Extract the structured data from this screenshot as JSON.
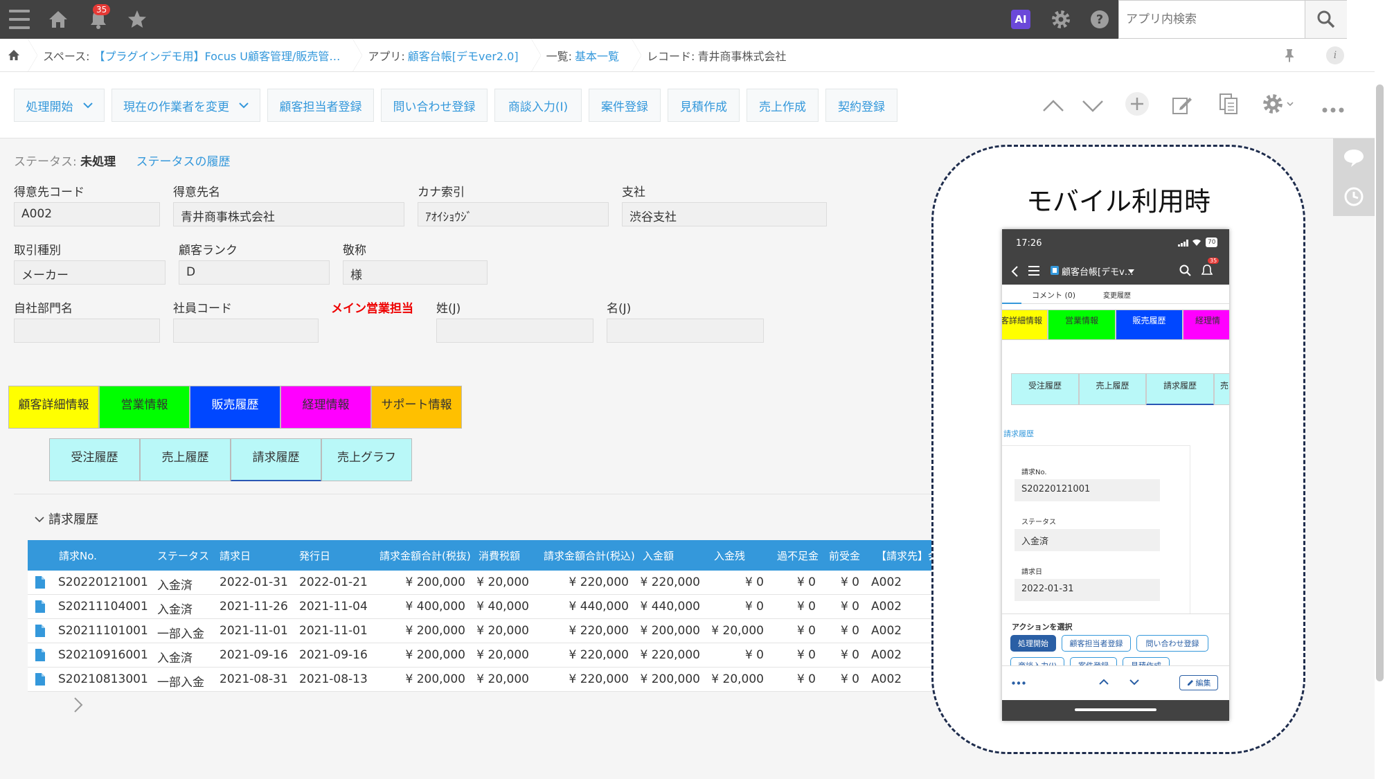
{
  "header": {
    "notification_count": "35",
    "ai_label": "AI",
    "search_placeholder": "アプリ内検索"
  },
  "breadcrumb": {
    "space_label": "スペース:",
    "space_name": "【プラグインデモ用】Focus U顧客管理/販売管…",
    "app_label": "アプリ:",
    "app_name": "顧客台帳[デモver2.0]",
    "view_label": "一覧:",
    "view_name": "基本一覧",
    "record_label": "レコード:",
    "record_name": "青井商事株式会社"
  },
  "toolbar": {
    "buttons": [
      "処理開始",
      "現在の作業者を変更",
      "顧客担当者登録",
      "問い合わせ登録",
      "商談入力(I)",
      "案件登録",
      "見積作成",
      "売上作成",
      "契約登録"
    ]
  },
  "status": {
    "label": "ステータス:",
    "value": "未処理",
    "history_link": "ステータスの履歴"
  },
  "fields": {
    "customer_code": {
      "label": "得意先コード",
      "value": "A002"
    },
    "customer_name": {
      "label": "得意先名",
      "value": "青井商事株式会社"
    },
    "kana": {
      "label": "カナ索引",
      "value": "ｱｵｲｼｮｳｼﾞ"
    },
    "branch": {
      "label": "支社",
      "value": "渋谷支社"
    },
    "trade_type": {
      "label": "取引種別",
      "value": "メーカー"
    },
    "customer_rank": {
      "label": "顧客ランク",
      "value": "D"
    },
    "honorific": {
      "label": "敬称",
      "value": "様"
    },
    "dept": {
      "label": "自社部門名",
      "value": ""
    },
    "employee_code": {
      "label": "社員コード",
      "value": ""
    },
    "main_sales": {
      "label": "メイン営業担当"
    },
    "last_name": {
      "label": "姓(J)",
      "value": ""
    },
    "first_name": {
      "label": "名(J)",
      "value": ""
    }
  },
  "tabs": [
    {
      "label": "顧客詳細情報",
      "color": "#ffff00"
    },
    {
      "label": "営業情報",
      "color": "#00ff00"
    },
    {
      "label": "販売履歴",
      "color": "#0047ff"
    },
    {
      "label": "経理情報",
      "color": "#ff00ff"
    },
    {
      "label": "サポート情報",
      "color": "#ffc000"
    }
  ],
  "subtabs": [
    "受注履歴",
    "売上履歴",
    "請求履歴",
    "売上グラフ"
  ],
  "section": {
    "title": "請求履歴"
  },
  "table": {
    "headers": [
      "請求No.",
      "ステータス",
      "請求日",
      "発行日",
      "請求金額合計(税抜)",
      "消費税額",
      "請求金額合計(税込)",
      "入金額",
      "入金残",
      "過不足金",
      "前受金",
      "【請求先】会"
    ],
    "rows": [
      [
        "S20220121001",
        "入金済",
        "2022-01-31",
        "2022-01-21",
        "¥ 200,000",
        "¥ 20,000",
        "¥ 220,000",
        "¥ 220,000",
        "¥ 0",
        "¥ 0",
        "¥ 0",
        "A002"
      ],
      [
        "S20211104001",
        "入金済",
        "2021-11-26",
        "2021-11-04",
        "¥ 400,000",
        "¥ 40,000",
        "¥ 440,000",
        "¥ 440,000",
        "¥ 0",
        "¥ 0",
        "¥ 0",
        "A002"
      ],
      [
        "S20211101001",
        "一部入金",
        "2021-11-01",
        "2021-11-01",
        "¥ 200,000",
        "¥ 20,000",
        "¥ 220,000",
        "¥ 200,000",
        "¥ 20,000",
        "¥ 0",
        "¥ 0",
        "A002"
      ],
      [
        "S20210916001",
        "入金済",
        "2021-09-16",
        "2021-09-16",
        "¥ 200,000",
        "¥ 20,000",
        "¥ 220,000",
        "¥ 220,000",
        "¥ 0",
        "¥ 0",
        "¥ 0",
        "A002"
      ],
      [
        "S20210813001",
        "一部入金",
        "2021-08-31",
        "2021-08-13",
        "¥ 200,000",
        "¥ 20,000",
        "¥ 220,000",
        "¥ 200,000",
        "¥ 20,000",
        "¥ 0",
        "¥ 0",
        "A002"
      ]
    ]
  },
  "mobile": {
    "title": "モバイル利用時",
    "time": "17:26",
    "battery": "70",
    "app_title": "顧客台帳[デモv…",
    "notif": "35",
    "comment_tab": "コメント (0)",
    "history_tab": "変更履歴",
    "tabs": [
      "客詳細情報",
      "営業情報",
      "販売履歴",
      "経理情"
    ],
    "subtabs": [
      "受注履歴",
      "売上履歴",
      "請求履歴",
      "売"
    ],
    "section_link": "請求履歴",
    "invoice_no_label": "請求No.",
    "invoice_no": "S20220121001",
    "status_label": "ステータス",
    "status_value": "入金済",
    "date_label": "請求日",
    "date_value": "2022-01-31",
    "action_label": "アクションを選択",
    "actions": [
      "処理開始",
      "顧客担当者登録",
      "問い合わせ登録",
      "商談入力(I)",
      "案件登録",
      "見積作成"
    ],
    "edit_label": "編集"
  }
}
